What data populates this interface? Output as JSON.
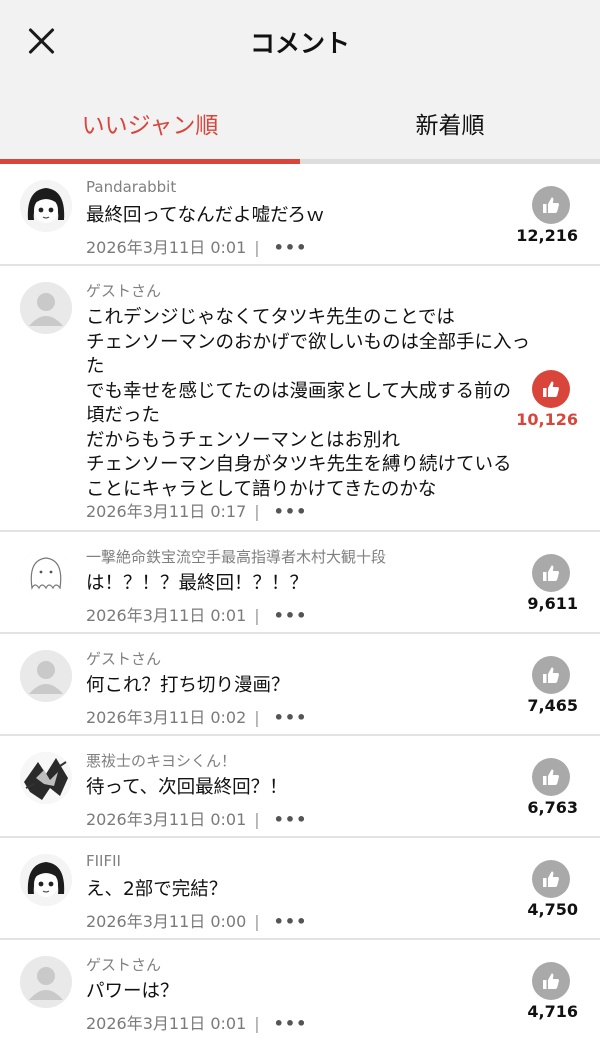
{
  "header": {
    "title": "コメント",
    "close_icon": "close-icon"
  },
  "tabs": [
    {
      "label": "いいジャン順",
      "active": true
    },
    {
      "label": "新着順",
      "active": false
    }
  ],
  "colors": {
    "accent": "#d9453a",
    "like_inactive": "#a9a9a9",
    "header_bg": "#f2f2f2"
  },
  "comments": [
    {
      "name": "Pandarabbit",
      "avatar": "avatar-manga-girl",
      "lines": [
        "最終回ってなんだよ嘘だろｗ"
      ],
      "date": "2026年3月11日 0:01",
      "sep": "|",
      "more": "•••",
      "likes": "12,216",
      "liked": false
    },
    {
      "name": "ゲストさん",
      "avatar": "avatar-guest",
      "lines": [
        "これデンジじゃなくてタツキ先生のことでは",
        "チェンソーマンのおかげで欲しいものは全部手に入っ",
        "た",
        "でも幸せを感じてたのは漫画家として大成する前の",
        "頃だった",
        "だからもうチェンソーマンとはお別れ",
        "チェンソーマン自身がタツキ先生を縛り続けている",
        "ことにキャラとして語りかけてきたのかな"
      ],
      "date": "2026年3月11日 0:17",
      "sep": "|",
      "more": "•••",
      "likes": "10,126",
      "liked": true
    },
    {
      "name": "一撃絶命鉄宝流空手最高指導者木村大観十段",
      "avatar": "avatar-ghost-sketch",
      "lines": [
        "は！？！？最終回！？！？"
      ],
      "date": "2026年3月11日 0:01",
      "sep": "|",
      "more": "•••",
      "likes": "9,611",
      "liked": false
    },
    {
      "name": "ゲストさん",
      "avatar": "avatar-guest",
      "lines": [
        "何これ？打ち切り漫画？"
      ],
      "date": "2026年3月11日 0:02",
      "sep": "|",
      "more": "•••",
      "likes": "7,465",
      "liked": false
    },
    {
      "name": "悪祓士のキヨシくん！",
      "avatar": "avatar-manga-action",
      "lines": [
        "待って、次回最終回？！"
      ],
      "date": "2026年3月11日 0:01",
      "sep": "|",
      "more": "•••",
      "likes": "6,763",
      "liked": false
    },
    {
      "name": "FIIFII",
      "avatar": "avatar-manga-girl",
      "lines": [
        "え、2部で完結？"
      ],
      "date": "2026年3月11日 0:00",
      "sep": "|",
      "more": "•••",
      "likes": "4,750",
      "liked": false
    },
    {
      "name": "ゲストさん",
      "avatar": "avatar-guest",
      "lines": [
        "パワーは？"
      ],
      "date": "2026年3月11日 0:01",
      "sep": "|",
      "more": "•••",
      "likes": "4,716",
      "liked": false
    }
  ]
}
